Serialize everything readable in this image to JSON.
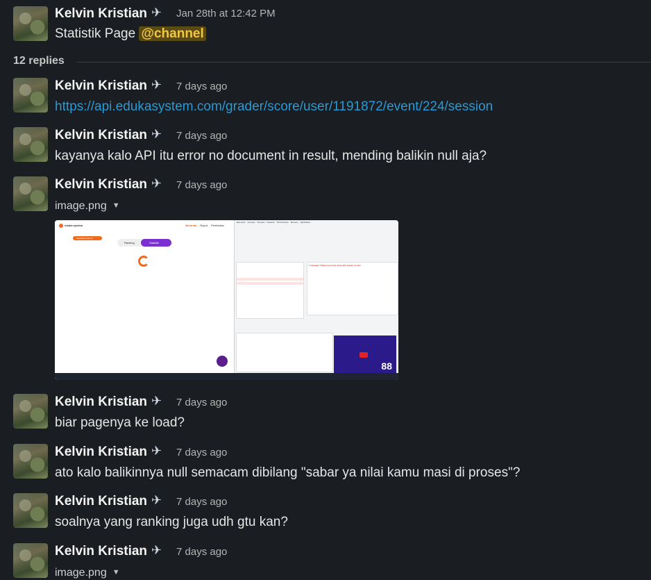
{
  "parent": {
    "author": "Kelvin Kristian",
    "timestamp": "Jan 28th at 12:42 PM",
    "text": "Statistik Page",
    "mention": "@channel"
  },
  "thread": {
    "replies_label": "12 replies"
  },
  "replies": [
    {
      "author": "Kelvin Kristian",
      "timestamp": "7 days ago",
      "type": "link",
      "text": "https://api.edukasystem.com/grader/score/user/1191872/event/224/session"
    },
    {
      "author": "Kelvin Kristian",
      "timestamp": "7 days ago",
      "type": "text",
      "text": "kayanya kalo API itu error no document in result, mending balikin null aja?"
    },
    {
      "author": "Kelvin Kristian",
      "timestamp": "7 days ago",
      "type": "file",
      "text": "image.png"
    },
    {
      "author": "Kelvin Kristian",
      "timestamp": "7 days ago",
      "type": "text",
      "text": "biar pagenya ke load?"
    },
    {
      "author": "Kelvin Kristian",
      "timestamp": "7 days ago",
      "type": "text",
      "text": "ato kalo balikinnya null semacam dibilang \"sabar ya nilai kamu masi di proses\"?"
    },
    {
      "author": "Kelvin Kristian",
      "timestamp": "7 days ago",
      "type": "text",
      "text": "soalnya yang ranking juga udh gtu kan?"
    },
    {
      "author": "Kelvin Kristian",
      "timestamp": "7 days ago",
      "type": "file",
      "text": "image.png"
    }
  ],
  "preview": {
    "brand": "eduka system",
    "nav": [
      "Beranda",
      "Rapot",
      "Pembelian"
    ],
    "button": "Kembali ke Event",
    "tabs": [
      "Ranking",
      "Statistik"
    ],
    "devtools_tabs": [
      "Elements",
      "Console",
      "Sources",
      "Network",
      "Performance",
      "Memory",
      "Application"
    ],
    "response_text": "{\"message\":\"failed to get user score with session of user"
  },
  "colors": {
    "link": "#2a9ad6",
    "mention_bg": "#5a4a14",
    "mention_fg": "#f2c744",
    "preview_orange": "#ef6c1f",
    "preview_purple": "#7b2fd0"
  }
}
